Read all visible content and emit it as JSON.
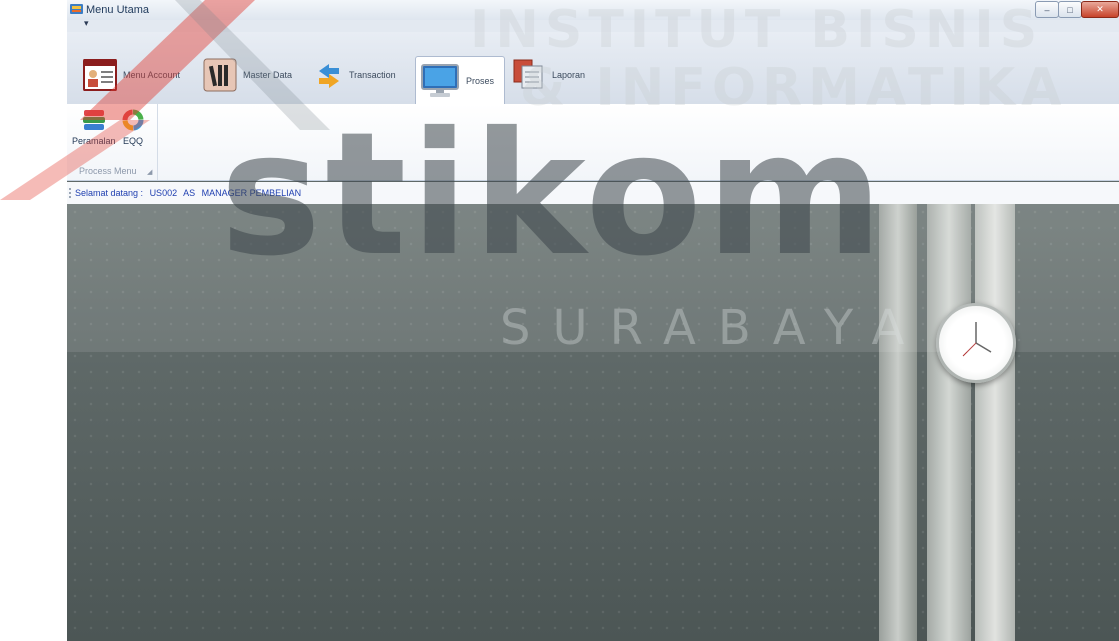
{
  "window": {
    "title": "Menu Utama",
    "controls": [
      "minimize",
      "maximize",
      "close"
    ],
    "controls_glyphs": {
      "minimize": "‒",
      "maximize": "□",
      "close": "✕"
    }
  },
  "quick_access": {
    "dropdown_glyph": "▾"
  },
  "ribbon": {
    "tabs": [
      {
        "label": "Menu Account",
        "icon": "account-icon"
      },
      {
        "label": "Master Data",
        "icon": "books-icon"
      },
      {
        "label": "Transaction",
        "icon": "transaction-arrows-icon"
      },
      {
        "label": "Proses",
        "icon": "monitor-icon"
      },
      {
        "label": "Laporan",
        "icon": "report-icon"
      }
    ],
    "active_tab": "Proses",
    "group": {
      "label": "Process Menu",
      "buttons": [
        {
          "label": "Peramalan",
          "icon": "stacked-books-icon"
        },
        {
          "label": "EQQ",
          "icon": "colored-ring-icon"
        }
      ]
    }
  },
  "status": {
    "greeting": "Selamat datang :",
    "user_id": "US002",
    "user_name": "AS",
    "role": "MANAGER PEMBELIAN"
  },
  "watermark": {
    "line1": "INSTITUT BISNIS",
    "line2": "& INFORMATIKA",
    "brand": "stikom",
    "city": "SURABAYA"
  },
  "colors": {
    "status_text": "#1f3fb0",
    "ribbon_bg": "#dfe6ef",
    "desktop_bg": "#5f6968"
  }
}
